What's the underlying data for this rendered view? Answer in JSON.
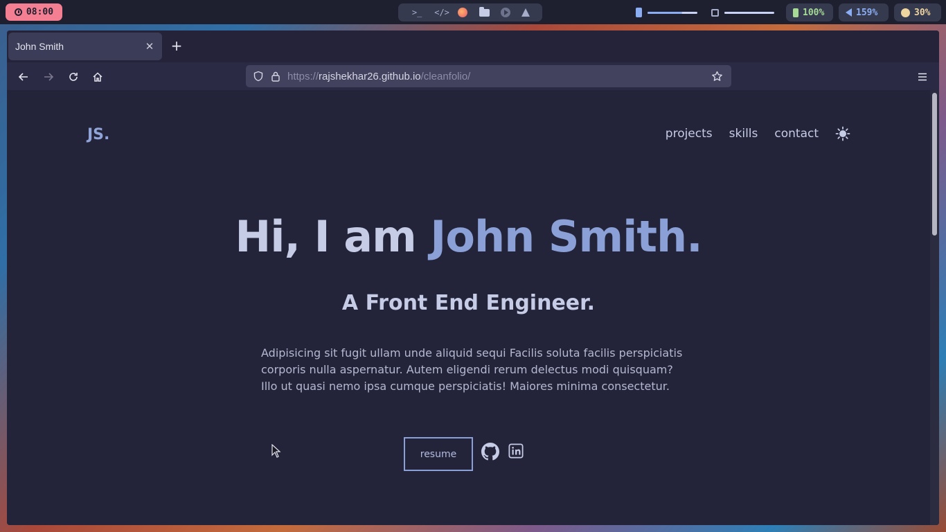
{
  "system_bar": {
    "clock": "08:00",
    "battery": "100%",
    "volume": "159%",
    "brightness": "30%",
    "brightness_level": 0.7,
    "cpu_level": 0.95,
    "colors": {
      "clock_bg": "#f57f92",
      "battery": "#a6da95",
      "volume": "#8aadf4",
      "brightness": "#eed49f"
    },
    "launcher_icons": [
      "terminal-icon",
      "code-icon",
      "firefox-icon",
      "folder-icon",
      "media-player-icon",
      "arch-icon"
    ]
  },
  "browser": {
    "tab_title": "John Smith",
    "url_scheme": "https://",
    "url_host": "rajshekhar26.github.io",
    "url_path": "/cleanfolio/"
  },
  "site": {
    "logo": "JS.",
    "nav": [
      "projects",
      "skills",
      "contact"
    ],
    "hero_greeting": "Hi, I am",
    "hero_name": "John Smith.",
    "hero_subtitle": "A Front End Engineer.",
    "hero_description": "Adipisicing sit fugit ullam unde aliquid sequi Facilis soluta facilis perspiciatis corporis nulla aspernatur. Autem eligendi rerum delectus modi quisquam? Illo ut quasi nemo ipsa cumque perspiciatis! Maiores minima consectetur.",
    "resume_label": "resume",
    "accent": "#8aa0d6",
    "background": "#23243a"
  }
}
